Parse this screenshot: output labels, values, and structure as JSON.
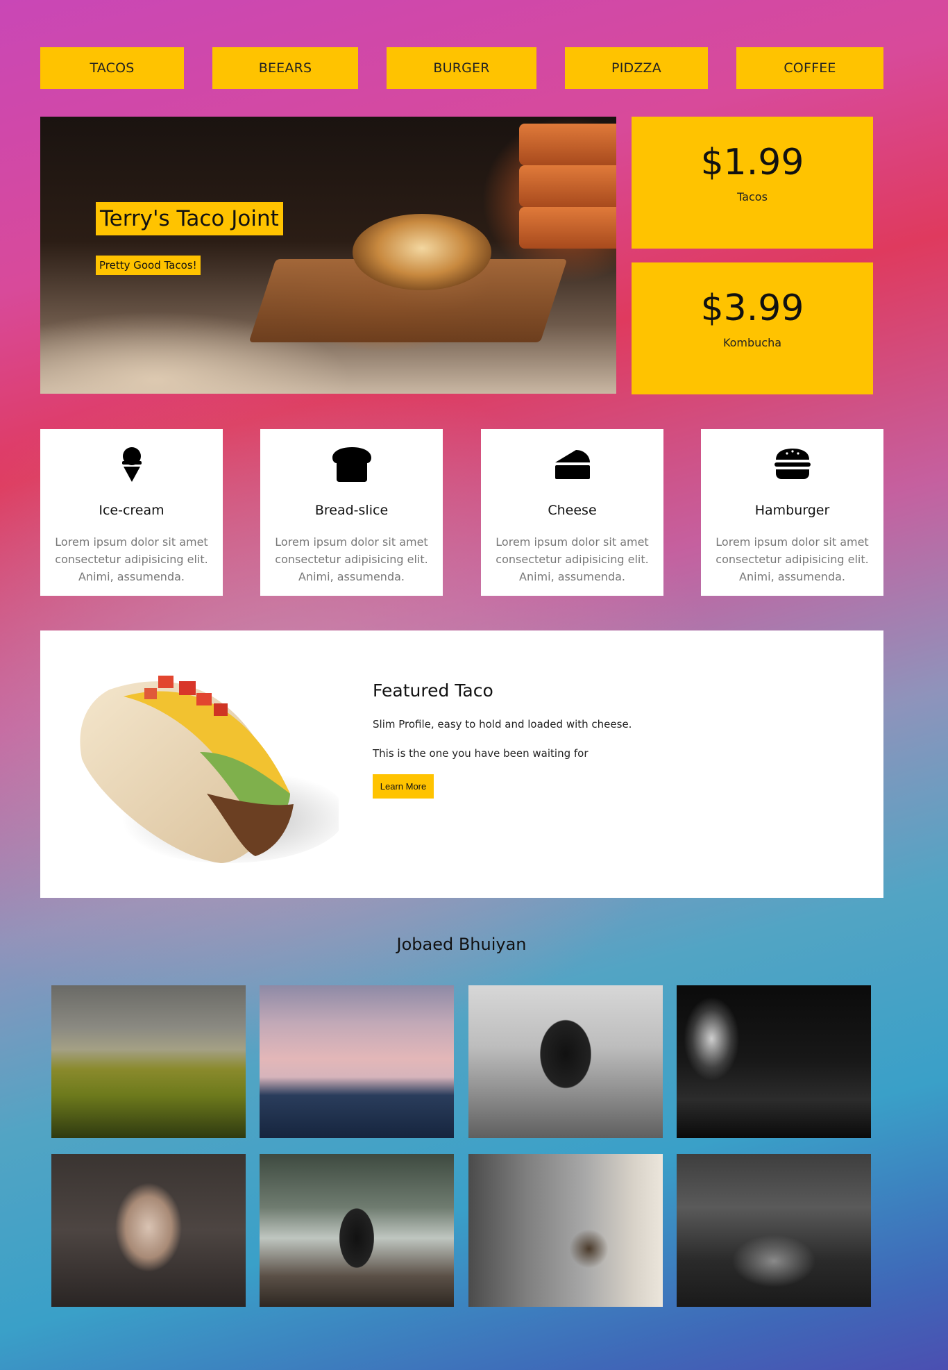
{
  "nav": {
    "items": [
      {
        "label": "TACOS"
      },
      {
        "label": "BEEARS"
      },
      {
        "label": "BURGER"
      },
      {
        "label": "PIDZZA"
      },
      {
        "label": "COFFEE"
      }
    ]
  },
  "hero": {
    "title": "Terry's Taco Joint",
    "subtitle": "Pretty Good Tacos!"
  },
  "prices": [
    {
      "amount": "$1.99",
      "label": "Tacos"
    },
    {
      "amount": "$3.99",
      "label": "Kombucha"
    }
  ],
  "cards": [
    {
      "icon": "ice-cream-icon",
      "title": "Ice-cream",
      "text": "Lorem ipsum dolor sit amet consectetur adipisicing elit. Animi, assumenda."
    },
    {
      "icon": "bread-slice-icon",
      "title": "Bread-slice",
      "text": "Lorem ipsum dolor sit amet consectetur adipisicing elit. Animi, assumenda."
    },
    {
      "icon": "cheese-icon",
      "title": "Cheese",
      "text": "Lorem ipsum dolor sit amet consectetur adipisicing elit. Animi, assumenda."
    },
    {
      "icon": "hamburger-icon",
      "title": "Hamburger",
      "text": "Lorem ipsum dolor sit amet consectetur adipisicing elit. Animi, assumenda."
    }
  ],
  "featured": {
    "title": "Featured Taco",
    "line1": "Slim Profile, easy to hold and loaded with cheese.",
    "line2": "This is the one you have been waiting for",
    "button": "Learn More"
  },
  "gallery": {
    "title": "Jobaed Bhuiyan",
    "photos": [
      {
        "name": "gallery-photo-hills"
      },
      {
        "name": "gallery-photo-mountain-dusk"
      },
      {
        "name": "gallery-photo-phone-sea"
      },
      {
        "name": "gallery-photo-blurred-dark"
      },
      {
        "name": "gallery-photo-portrait"
      },
      {
        "name": "gallery-photo-phone-waterfall"
      },
      {
        "name": "gallery-photo-desk-lamp"
      },
      {
        "name": "gallery-photo-crowd"
      }
    ]
  },
  "colors": {
    "accent": "#ffc300",
    "card_bg": "#ffffff",
    "muted_text": "#777777"
  }
}
